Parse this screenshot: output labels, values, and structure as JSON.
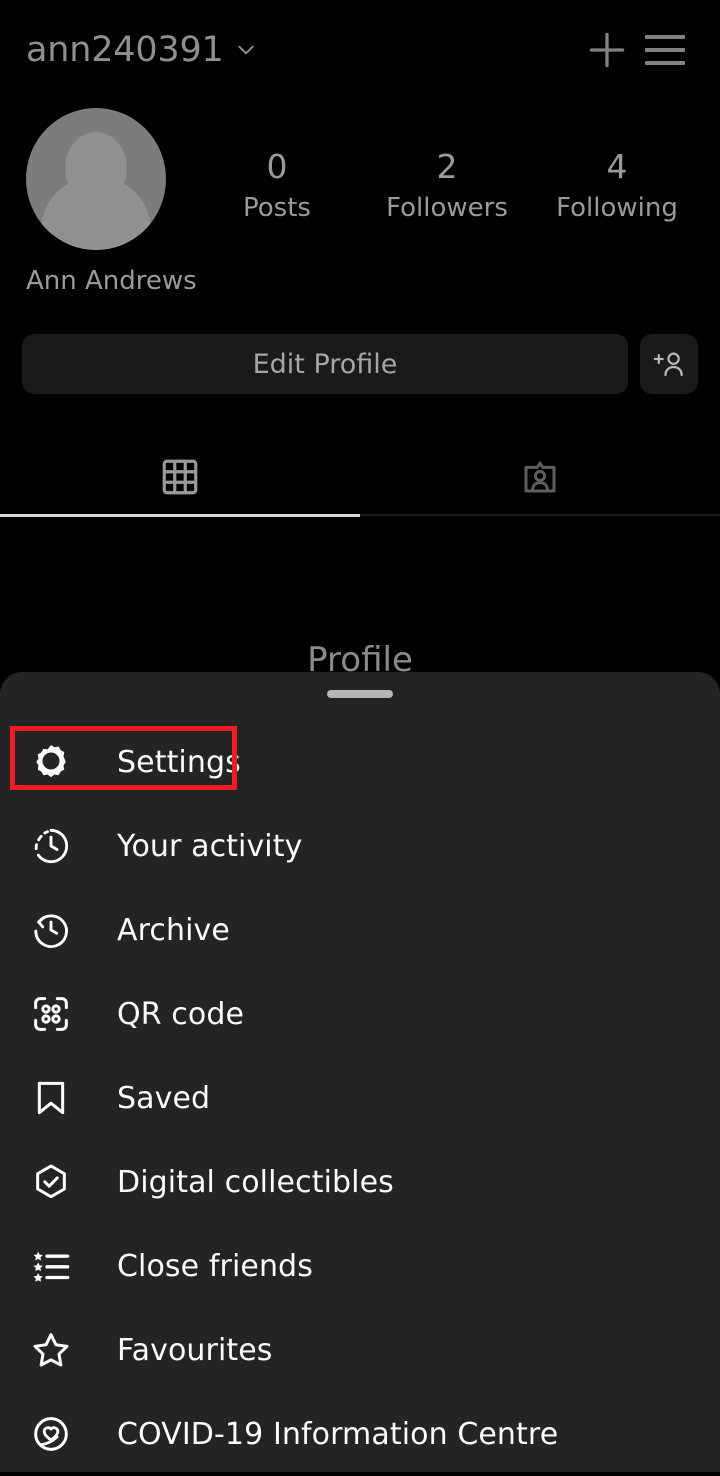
{
  "topbar": {
    "username": "ann240391",
    "chevron_icon": "chevron-down-icon",
    "add_icon": "plus-icon",
    "menu_icon": "hamburger-menu-icon"
  },
  "profile": {
    "avatar_icon": "default-avatar-icon",
    "full_name": "Ann Andrews",
    "stats": [
      {
        "value": "0",
        "label": "Posts"
      },
      {
        "value": "2",
        "label": "Followers"
      },
      {
        "value": "4",
        "label": "Following"
      }
    ]
  },
  "actions": {
    "edit_profile_label": "Edit Profile",
    "add_person_icon": "add-person-icon"
  },
  "tabs": [
    {
      "name": "grid",
      "icon": "grid-icon",
      "active": true
    },
    {
      "name": "tagged",
      "icon": "tagged-person-icon",
      "active": false
    }
  ],
  "background": {
    "page_title": "Profile"
  },
  "sheet": {
    "grabber_icon": "drag-handle",
    "highlight_color": "#ee1c25",
    "items": [
      {
        "label": "Settings",
        "icon": "gear-icon",
        "highlighted": true
      },
      {
        "label": "Your activity",
        "icon": "clock-activity-icon",
        "highlighted": false
      },
      {
        "label": "Archive",
        "icon": "archive-clock-rewind-icon",
        "highlighted": false
      },
      {
        "label": "QR code",
        "icon": "qr-code-icon",
        "highlighted": false
      },
      {
        "label": "Saved",
        "icon": "bookmark-icon",
        "highlighted": false
      },
      {
        "label": "Digital collectibles",
        "icon": "hexagon-check-icon",
        "highlighted": false
      },
      {
        "label": "Close friends",
        "icon": "star-list-icon",
        "highlighted": false
      },
      {
        "label": "Favourites",
        "icon": "star-outline-icon",
        "highlighted": false
      },
      {
        "label": "COVID-19 Information Centre",
        "icon": "covid-heart-icon",
        "highlighted": false
      }
    ]
  }
}
